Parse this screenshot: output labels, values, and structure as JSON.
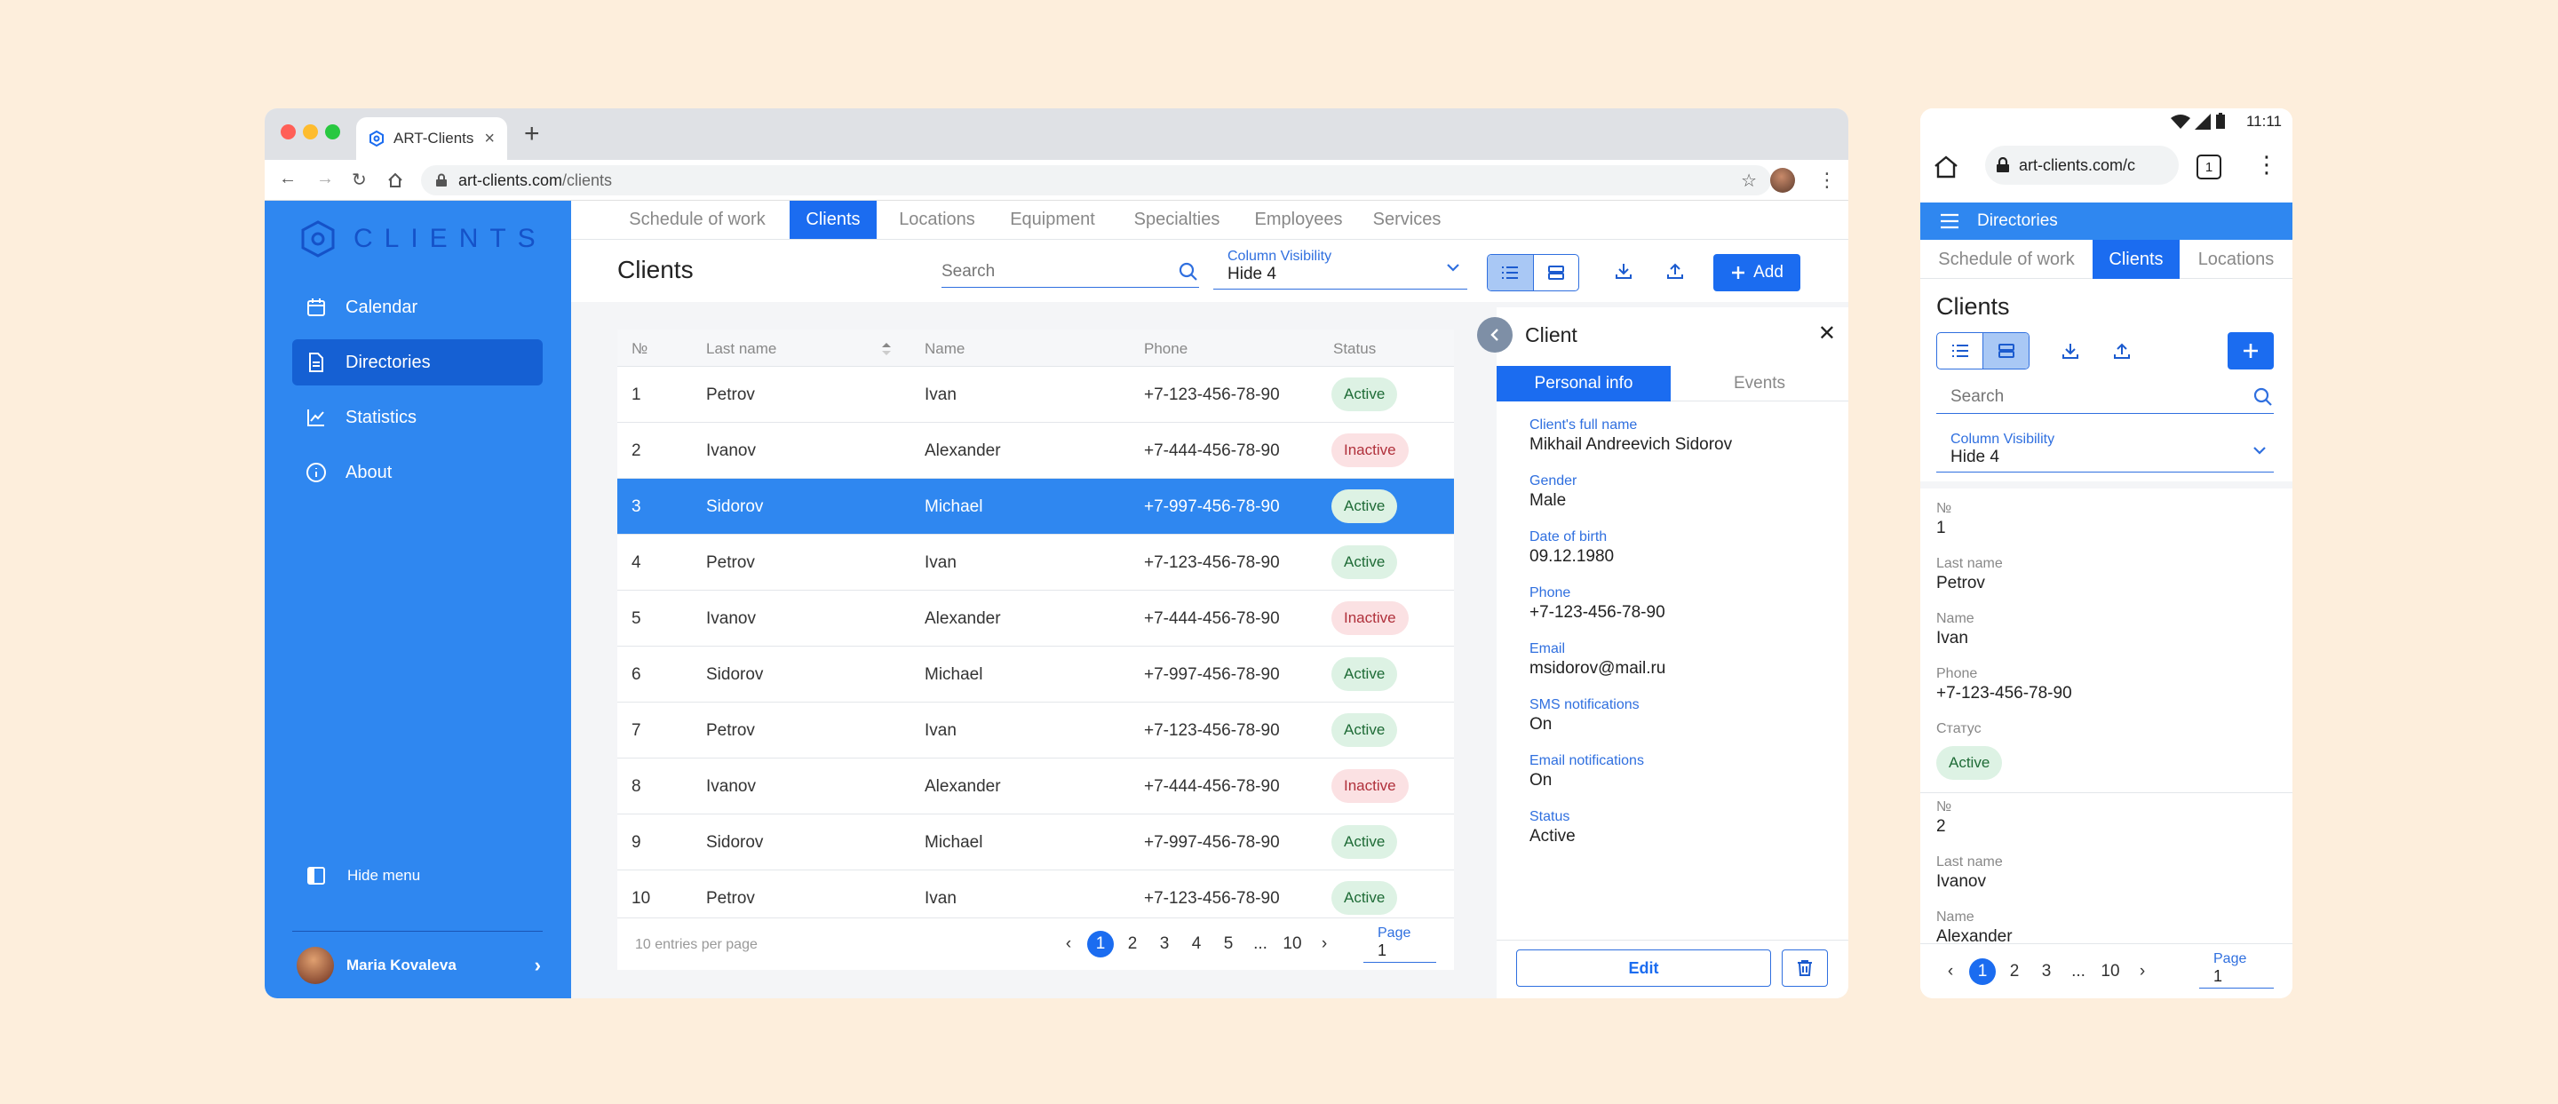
{
  "desktop": {
    "tab_title": "ART-Clients",
    "url_domain": "art-clients.com",
    "url_path": "/clients",
    "logo_text": "CLIENTS",
    "sidebar": {
      "items": [
        {
          "label": "Calendar",
          "icon": "calendar-icon"
        },
        {
          "label": "Directories",
          "icon": "document-icon",
          "active": true
        },
        {
          "label": "Statistics",
          "icon": "chart-icon"
        },
        {
          "label": "About",
          "icon": "info-icon"
        }
      ],
      "hide_menu": "Hide menu",
      "user_name": "Maria Kovaleva"
    },
    "top_tabs": [
      "Schedule of work",
      "Clients",
      "Locations",
      "Equipment",
      "Specialties",
      "Employees",
      "Services"
    ],
    "active_tab": "Clients",
    "page_title": "Clients",
    "search_placeholder": "Search",
    "column_visibility": {
      "label": "Column Visibility",
      "value": "Hide 4"
    },
    "add_label": "Add",
    "table": {
      "headers": [
        "№",
        "Last name",
        "Name",
        "Phone",
        "Status"
      ],
      "rows": [
        {
          "n": "1",
          "last": "Petrov",
          "name": "Ivan",
          "phone": "+7-123-456-78-90",
          "status": "Active"
        },
        {
          "n": "2",
          "last": "Ivanov",
          "name": "Alexander",
          "phone": "+7-444-456-78-90",
          "status": "Inactive"
        },
        {
          "n": "3",
          "last": "Sidorov",
          "name": "Michael",
          "phone": "+7-997-456-78-90",
          "status": "Active"
        },
        {
          "n": "4",
          "last": "Petrov",
          "name": "Ivan",
          "phone": "+7-123-456-78-90",
          "status": "Active"
        },
        {
          "n": "5",
          "last": "Ivanov",
          "name": "Alexander",
          "phone": "+7-444-456-78-90",
          "status": "Inactive"
        },
        {
          "n": "6",
          "last": "Sidorov",
          "name": "Michael",
          "phone": "+7-997-456-78-90",
          "status": "Active"
        },
        {
          "n": "7",
          "last": "Petrov",
          "name": "Ivan",
          "phone": "+7-123-456-78-90",
          "status": "Active"
        },
        {
          "n": "8",
          "last": "Ivanov",
          "name": "Alexander",
          "phone": "+7-444-456-78-90",
          "status": "Inactive"
        },
        {
          "n": "9",
          "last": "Sidorov",
          "name": "Michael",
          "phone": "+7-997-456-78-90",
          "status": "Active"
        },
        {
          "n": "10",
          "last": "Petrov",
          "name": "Ivan",
          "phone": "+7-123-456-78-90",
          "status": "Active"
        }
      ],
      "selected_row": "3",
      "per_page": "10 entries per page",
      "pages": [
        "1",
        "2",
        "3",
        "4",
        "5",
        "...",
        "10"
      ],
      "current_page": "1",
      "page_label": "Page",
      "page_value": "1"
    },
    "panel": {
      "title": "Client",
      "tabs": [
        "Personal info",
        "Events"
      ],
      "fields": [
        {
          "label": "Client's full name",
          "value": "Mikhail Andreevich Sidorov"
        },
        {
          "label": "Gender",
          "value": "Male"
        },
        {
          "label": "Date of birth",
          "value": "09.12.1980"
        },
        {
          "label": "Phone",
          "value": "+7-123-456-78-90"
        },
        {
          "label": "Email",
          "value": "msidorov@mail.ru"
        },
        {
          "label": "SMS notifications",
          "value": "On"
        },
        {
          "label": "Email notifications",
          "value": "On"
        },
        {
          "label": "Status",
          "value": "Active"
        }
      ],
      "edit_label": "Edit"
    }
  },
  "mobile": {
    "time": "11:11",
    "url": "art-clients.com/c",
    "tab_count": "1",
    "appbar_title": "Directories",
    "tabs": [
      "Schedule of work",
      "Clients",
      "Locations"
    ],
    "page_title": "Clients",
    "search_placeholder": "Search",
    "column_visibility": {
      "label": "Column Visibility",
      "value": "Hide 4"
    },
    "cards": [
      {
        "n_label": "№",
        "n": "1",
        "last_label": "Last name",
        "last": "Petrov",
        "name_label": "Name",
        "name": "Ivan",
        "phone_label": "Phone",
        "phone": "+7-123-456-78-90",
        "status_label": "Статус",
        "status": "Active"
      },
      {
        "n_label": "№",
        "n": "2",
        "last_label": "Last name",
        "last": "Ivanov",
        "name_label": "Name",
        "name": "Alexander"
      }
    ],
    "pages": [
      "1",
      "2",
      "3",
      "...",
      "10"
    ],
    "current_page": "1",
    "page_label": "Page",
    "page_value": "1"
  },
  "colors": {
    "accent": "#1B6CF0",
    "sidebar": "#2F87F0",
    "background": "#FDEEDC"
  }
}
